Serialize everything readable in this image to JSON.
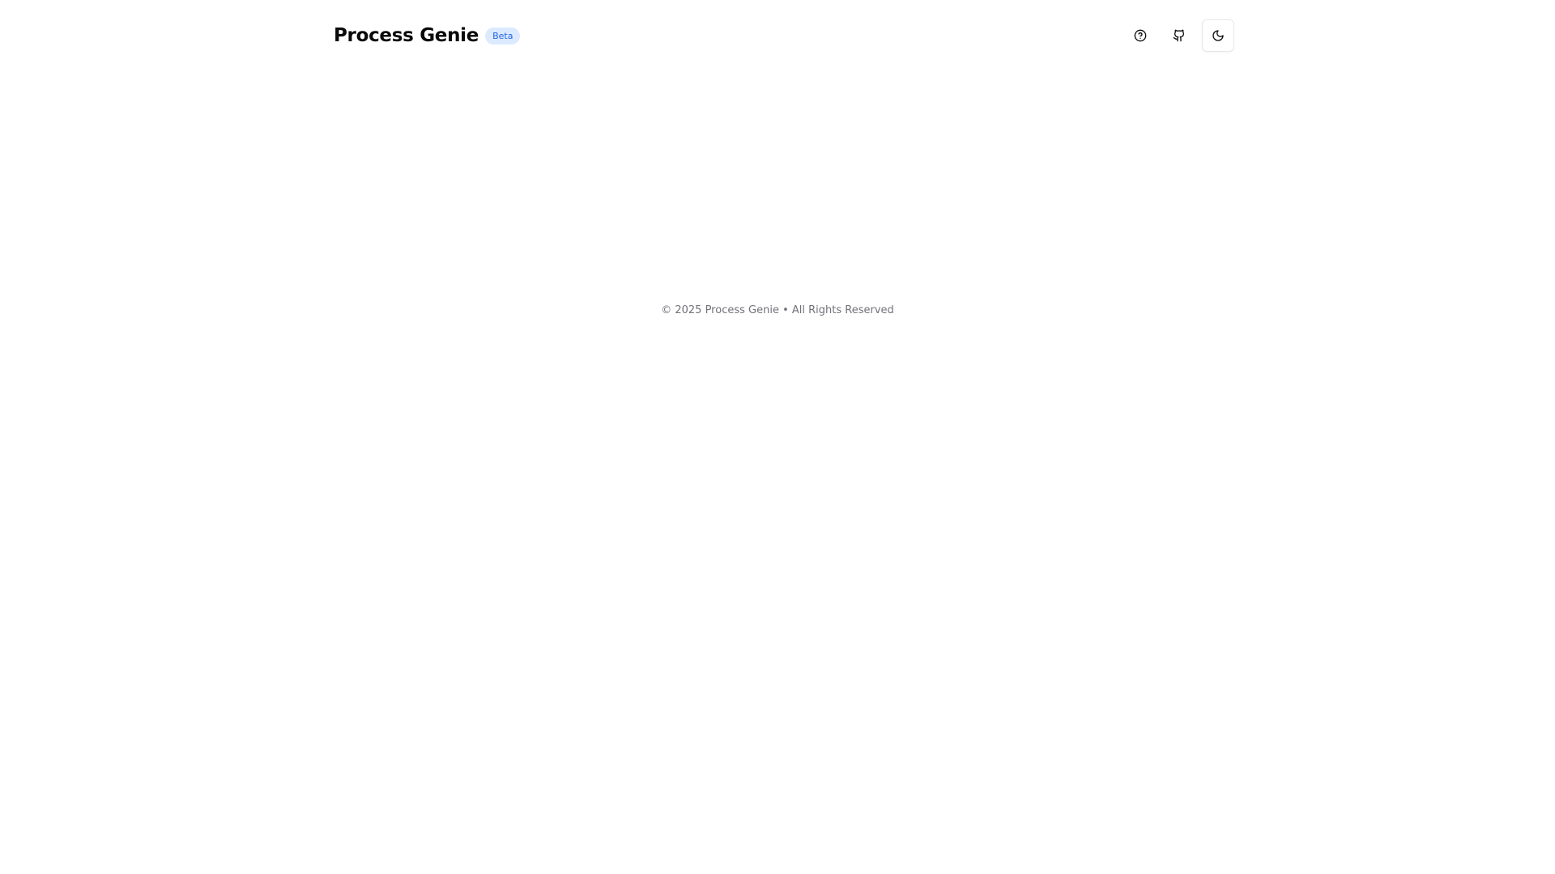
{
  "header": {
    "title": "Process Genie",
    "badge": "Beta",
    "actions": [
      {
        "icon": "help-circle-icon",
        "label": "Help"
      },
      {
        "icon": "github-icon",
        "label": "GitHub"
      },
      {
        "icon": "moon-icon",
        "label": "Toggle theme"
      }
    ]
  },
  "footer": {
    "text": "© 2025 Process Genie • All Rights Reserved"
  },
  "colors": {
    "badge_background": "#dbeafe",
    "badge_text": "#2563eb",
    "footer_text": "#71717a",
    "title_text": "#0a0a0a"
  }
}
